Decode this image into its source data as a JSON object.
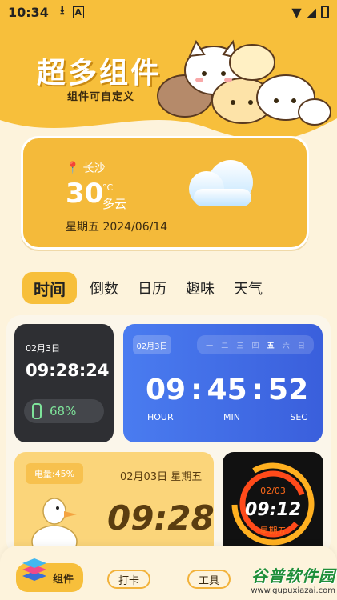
{
  "status_bar": {
    "time": "10:34"
  },
  "header": {
    "title": "超多组件",
    "subtitle": "组件可自定义"
  },
  "weather": {
    "city": "长沙",
    "temperature": "30",
    "unit": "°C",
    "condition": "多云",
    "date": "星期五 2024/06/14"
  },
  "tabs": [
    "时间",
    "倒数",
    "日历",
    "趣味",
    "天气"
  ],
  "widgets": {
    "dark_clock": {
      "date": "02月3日",
      "time": "09:28:24",
      "battery": "68%"
    },
    "blue_clock": {
      "date": "02月3日",
      "weekdays": [
        "一",
        "二",
        "三",
        "四",
        "五",
        "六",
        "日"
      ],
      "hour": "09",
      "min": "45",
      "sec": "52",
      "hour_label": "HOUR",
      "min_label": "MIN",
      "sec_label": "SEC"
    },
    "yellow_clock": {
      "battery": "电量:45%",
      "date": "02月03日 星期五",
      "time": "09:28"
    },
    "ring_clock": {
      "date": "02/03",
      "time": "09:12",
      "weekday": "星期五"
    }
  },
  "bottom_nav": {
    "widgets": "组件",
    "checkin": "打卡",
    "tools": "工具"
  },
  "watermark": {
    "title": "谷普软件园",
    "url": "www.gupuxiazai.com"
  },
  "colors": {
    "accent": "#f7bf3b",
    "background": "#fdf3dc",
    "blue": "#4a7cf0"
  }
}
